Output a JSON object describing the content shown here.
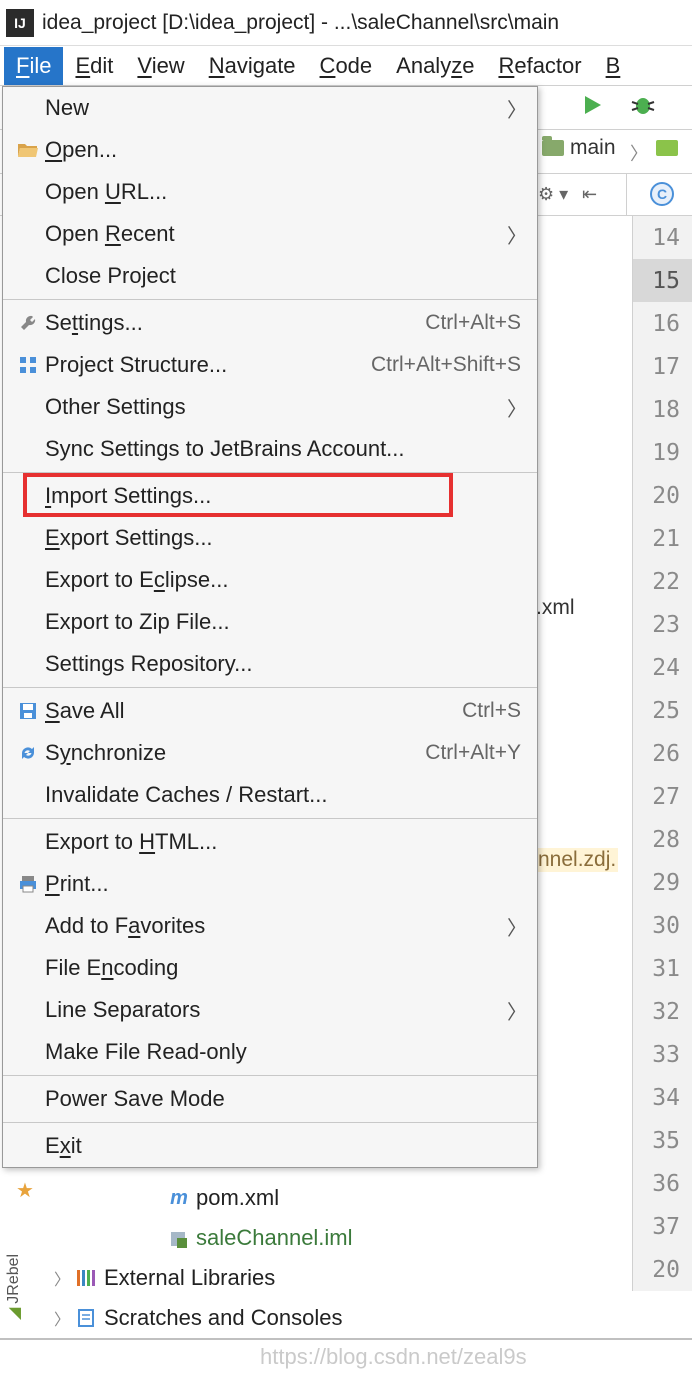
{
  "titlebar": {
    "app_icon_text": "IJ",
    "title": "idea_project [D:\\idea_project] - ...\\saleChannel\\src\\main"
  },
  "menubar": {
    "items": [
      {
        "label": "File",
        "mnemonic": "F",
        "active": true
      },
      {
        "label": "Edit",
        "mnemonic": "E",
        "active": false
      },
      {
        "label": "View",
        "mnemonic": "V",
        "active": false
      },
      {
        "label": "Navigate",
        "mnemonic": "N",
        "active": false
      },
      {
        "label": "Code",
        "mnemonic": "C",
        "active": false
      },
      {
        "label": "Analyze",
        "mnemonic": "z",
        "active": false
      },
      {
        "label": "Refactor",
        "mnemonic": "R",
        "active": false
      },
      {
        "label": "B",
        "mnemonic": "B",
        "active": false
      }
    ]
  },
  "breadcrumb": {
    "folder": "main"
  },
  "file_tab": {
    "letter": "C"
  },
  "dropdown": {
    "groups": [
      [
        {
          "label": "New",
          "mnemonic": "",
          "shortcut": "",
          "submenu": true,
          "icon": ""
        },
        {
          "label": "Open...",
          "mnemonic": "O",
          "shortcut": "",
          "submenu": false,
          "icon": "folder-open"
        },
        {
          "label": "Open URL...",
          "mnemonic": "U",
          "shortcut": "",
          "submenu": false,
          "icon": ""
        },
        {
          "label": "Open Recent",
          "mnemonic": "R",
          "shortcut": "",
          "submenu": true,
          "icon": ""
        },
        {
          "label": "Close Project",
          "mnemonic": "j",
          "shortcut": "",
          "submenu": false,
          "icon": ""
        }
      ],
      [
        {
          "label": "Settings...",
          "mnemonic": "t",
          "shortcut": "Ctrl+Alt+S",
          "submenu": false,
          "icon": "wrench"
        },
        {
          "label": "Project Structure...",
          "mnemonic": "",
          "shortcut": "Ctrl+Alt+Shift+S",
          "submenu": false,
          "icon": "structure"
        },
        {
          "label": "Other Settings",
          "mnemonic": "",
          "shortcut": "",
          "submenu": true,
          "icon": ""
        },
        {
          "label": "Sync Settings to JetBrains Account...",
          "mnemonic": "",
          "shortcut": "",
          "submenu": false,
          "icon": ""
        }
      ],
      [
        {
          "label": "Import Settings...",
          "mnemonic": "I",
          "shortcut": "",
          "submenu": false,
          "icon": "",
          "highlighted": true
        },
        {
          "label": "Export Settings...",
          "mnemonic": "E",
          "shortcut": "",
          "submenu": false,
          "icon": ""
        },
        {
          "label": "Export to Eclipse...",
          "mnemonic": "c",
          "shortcut": "",
          "submenu": false,
          "icon": ""
        },
        {
          "label": "Export to Zip File...",
          "mnemonic": "",
          "shortcut": "",
          "submenu": false,
          "icon": ""
        },
        {
          "label": "Settings Repository...",
          "mnemonic": "",
          "shortcut": "",
          "submenu": false,
          "icon": ""
        }
      ],
      [
        {
          "label": "Save All",
          "mnemonic": "S",
          "shortcut": "Ctrl+S",
          "submenu": false,
          "icon": "save"
        },
        {
          "label": "Synchronize",
          "mnemonic": "y",
          "shortcut": "Ctrl+Alt+Y",
          "submenu": false,
          "icon": "sync"
        },
        {
          "label": "Invalidate Caches / Restart...",
          "mnemonic": "",
          "shortcut": "",
          "submenu": false,
          "icon": ""
        }
      ],
      [
        {
          "label": "Export to HTML...",
          "mnemonic": "H",
          "shortcut": "",
          "submenu": false,
          "icon": ""
        },
        {
          "label": "Print...",
          "mnemonic": "P",
          "shortcut": "",
          "submenu": false,
          "icon": "print"
        },
        {
          "label": "Add to Favorites",
          "mnemonic": "a",
          "shortcut": "",
          "submenu": true,
          "icon": ""
        },
        {
          "label": "File Encoding",
          "mnemonic": "n",
          "shortcut": "",
          "submenu": false,
          "icon": ""
        },
        {
          "label": "Line Separators",
          "mnemonic": "",
          "shortcut": "",
          "submenu": true,
          "icon": ""
        },
        {
          "label": "Make File Read-only",
          "mnemonic": "",
          "shortcut": "",
          "submenu": false,
          "icon": ""
        }
      ],
      [
        {
          "label": "Power Save Mode",
          "mnemonic": "",
          "shortcut": "",
          "submenu": false,
          "icon": ""
        }
      ],
      [
        {
          "label": "Exit",
          "mnemonic": "x",
          "shortcut": "",
          "submenu": false,
          "icon": ""
        }
      ]
    ]
  },
  "gutter": {
    "lines": [
      14,
      15,
      16,
      17,
      18,
      19,
      20,
      21,
      22,
      23,
      24,
      25,
      26,
      27,
      28,
      29,
      30,
      31,
      32,
      33,
      34,
      35,
      36,
      37,
      "20"
    ],
    "current": 15
  },
  "behind": {
    "xml": ".xml",
    "pkg": "nnel.zdj."
  },
  "project": {
    "pom": "pom.xml",
    "iml": "saleChannel.iml",
    "ext": "External Libraries",
    "scratch": "Scratches and Consoles"
  },
  "sidebar": {
    "label": "JRebel"
  },
  "watermark": "https://blog.csdn.net/zeal9s"
}
